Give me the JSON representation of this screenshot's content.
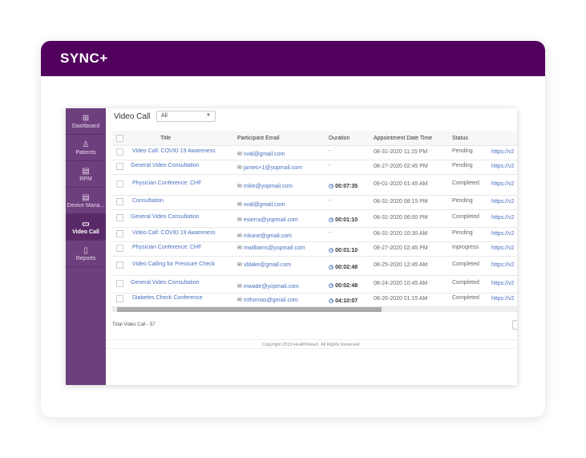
{
  "header": {
    "logo": "SYNC+",
    "brand_color": "#52005e"
  },
  "sidebar": {
    "items": [
      {
        "label": "Dashboard",
        "icon": "grid-icon",
        "active": false
      },
      {
        "label": "Patients",
        "icon": "user-icon",
        "active": false
      },
      {
        "label": "RPM",
        "icon": "document-icon",
        "active": false
      },
      {
        "label": "Device Mana...",
        "icon": "document-icon",
        "active": false
      },
      {
        "label": "Video Call",
        "icon": "video-icon",
        "active": true
      },
      {
        "label": "Reports",
        "icon": "file-icon",
        "active": false
      }
    ]
  },
  "page": {
    "title": "Video Call",
    "filter_value": "All"
  },
  "table": {
    "columns": [
      "Title",
      "Participant Email",
      "Duration",
      "Appointment Date Time",
      "Status"
    ],
    "rows": [
      {
        "title": "Video Call: COVID 19 Awareness",
        "email": "vval@gmail.com",
        "duration": "-",
        "date": "08-31-2020 11:15 PM",
        "status": "Pending",
        "link": "https://v2"
      },
      {
        "title": "General Video Consultation",
        "email": "james+1@yopmail.com",
        "duration": "-",
        "date": "08-27-2020 02:45 PM",
        "status": "Pending",
        "link": "https://v2"
      },
      {
        "title": "Physician Conference: CHF",
        "email": "mike@yopmail.com",
        "duration": "00:07:35",
        "date": "09-01-2020 01:45 AM",
        "status": "Completed",
        "link": "https://v2"
      },
      {
        "title": "Consultation",
        "email": "vval@gmail.com",
        "duration": "-",
        "date": "08-31-2020 08:15 PM",
        "status": "Pending",
        "link": "https://v2"
      },
      {
        "title": "General Video Consultation",
        "email": "esierra@yopmail.com",
        "duration": "00:01:10",
        "date": "08-31-2020 06:00 PM",
        "status": "Completed",
        "link": "https://v2"
      },
      {
        "title": "Video Call: COVID 19 Awareness",
        "email": "mkane@gmail.com",
        "duration": "-",
        "date": "08-31-2020 10:30 AM",
        "status": "Pending",
        "link": "https://v2"
      },
      {
        "title": "Physician Conference: CHF",
        "email": "mwilliams@yopmail.com",
        "duration": "00:01:10",
        "date": "08-27-2020 02:45 PM",
        "status": "Inprogress",
        "link": "https://v2"
      },
      {
        "title": "Video Calling for Pressure Check",
        "email": "vblake@gmail.com",
        "duration": "00:02:48",
        "date": "08-25-2020 12:45 AM",
        "status": "Completed",
        "link": "https://v2"
      },
      {
        "title": "General Video Consultation",
        "email": "mwade@yopmail.com",
        "duration": "00:02:48",
        "date": "08-24-2020 10:45 AM",
        "status": "Completed",
        "link": "https://v2"
      },
      {
        "title": "Diabetes Check Conference",
        "email": "mthomas@gmail.com",
        "duration": "04:10:07",
        "date": "08-26-2020 01:15 AM",
        "status": "Completed",
        "link": "https://v2"
      }
    ]
  },
  "total": "Total Video Call - 57",
  "footer": "Copyright 2019 HealthViewX. All Rights Reserved."
}
